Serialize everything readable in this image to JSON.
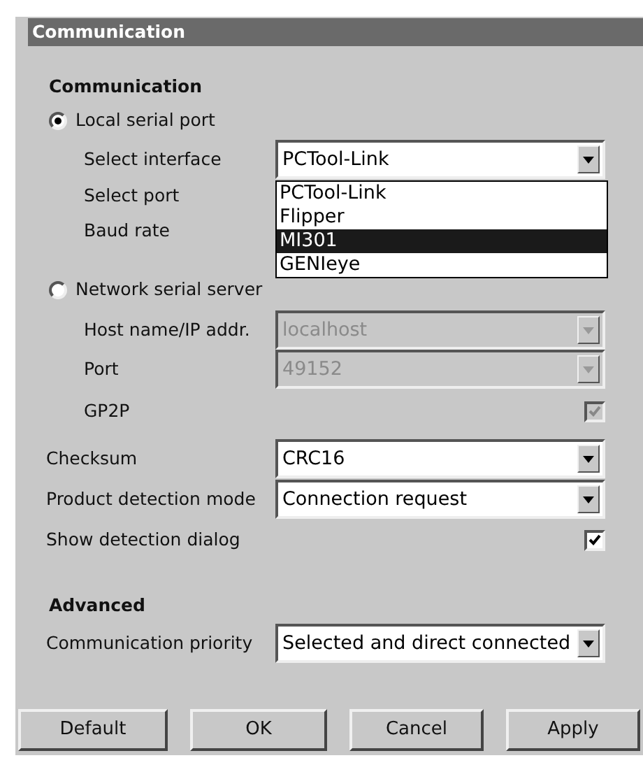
{
  "window": {
    "title": "Communication"
  },
  "communication": {
    "heading": "Communication",
    "options": [
      {
        "label": "Local serial port",
        "selected": true,
        "fields": [
          {
            "label": "Select interface",
            "kind": "dropdown",
            "value": "PCTool-Link",
            "disabled": false
          },
          {
            "label": "Select port",
            "kind": "label"
          },
          {
            "label": "Baud rate",
            "kind": "label"
          }
        ]
      },
      {
        "label": "Network serial server",
        "selected": false,
        "fields": [
          {
            "label": "Host name/IP addr.",
            "kind": "dropdown",
            "value": "localhost",
            "disabled": true
          },
          {
            "label": "Port",
            "kind": "dropdown",
            "value": "49152",
            "disabled": true
          },
          {
            "label": "GP2P",
            "kind": "checkbox",
            "checked": true,
            "disabled": true
          }
        ]
      }
    ],
    "open_list": [
      {
        "label": "PCTool-Link",
        "selected": false
      },
      {
        "label": "Flipper",
        "selected": false
      },
      {
        "label": "MI301",
        "selected": true
      },
      {
        "label": "GENIeye",
        "selected": false
      }
    ],
    "settings": [
      {
        "label": "Checksum",
        "kind": "dropdown",
        "value": "CRC16",
        "disabled": false
      },
      {
        "label": "Product detection mode",
        "kind": "dropdown",
        "value": "Connection request",
        "disabled": false
      },
      {
        "label": "Show detection dialog",
        "kind": "checkbox",
        "checked": true,
        "disabled": false
      }
    ]
  },
  "advanced": {
    "heading": "Advanced",
    "settings": [
      {
        "label": "Communication priority",
        "kind": "dropdown",
        "value": "Selected and direct connected",
        "disabled": false
      }
    ]
  },
  "buttons": [
    "Default",
    "OK",
    "Cancel",
    "Apply"
  ]
}
